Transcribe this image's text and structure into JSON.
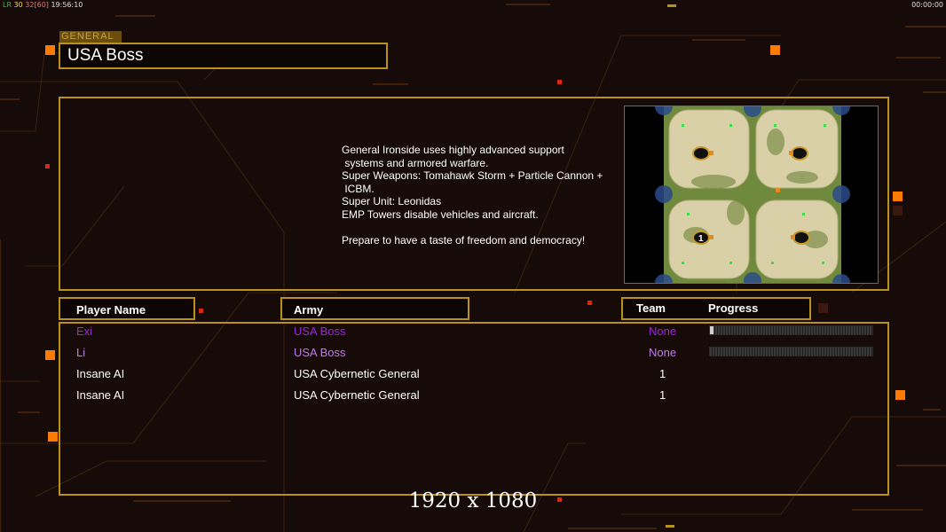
{
  "hud": {
    "fps_a": "LR",
    "fps_b": "30",
    "fps_c": "32[60]",
    "clock": "19:56:10",
    "timer": "00:00:00"
  },
  "general": {
    "tag": "GENERAL",
    "name": "USA Boss"
  },
  "description": "General Ironside uses highly advanced support\n systems and armored warfare.\nSuper Weapons: Tomahawk Storm + Particle Cannon +\n ICBM.\nSuper Unit: Leonidas\nEMP Towers disable vehicles and aircraft.\n\nPrepare to have a taste of freedom and democracy!",
  "map": {
    "start_marker": "1"
  },
  "table": {
    "headers": {
      "player": "Player Name",
      "army": "Army",
      "team": "Team",
      "progress": "Progress"
    },
    "rows": [
      {
        "player": "Exi",
        "army": "USA Boss",
        "team": "None",
        "progress": 0.02,
        "color": "#9c27d8"
      },
      {
        "player": "Li",
        "army": "USA Boss",
        "team": "None",
        "progress": 0.0,
        "color": "#9c27d8"
      },
      {
        "player": "Insane AI",
        "army": "USA Cybernetic General",
        "team": "1",
        "color": "#ffffff"
      },
      {
        "player": "Insane AI",
        "army": "USA Cybernetic General",
        "team": "1",
        "color": "#ffffff"
      }
    ]
  },
  "resolution_label": "1920 x 1080",
  "colors": {
    "accent_gold": "#b8921a",
    "accent_orange": "#ff7a00",
    "background": "#160b08"
  }
}
